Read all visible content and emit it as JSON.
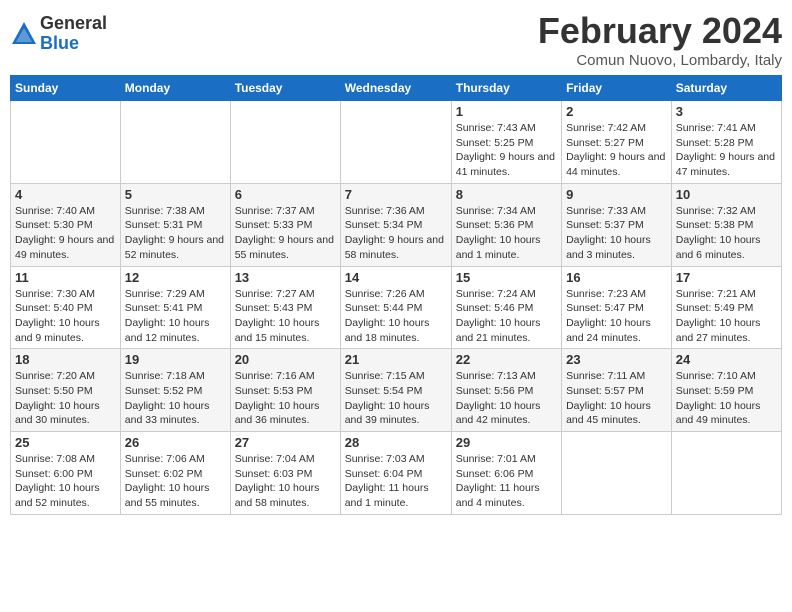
{
  "logo": {
    "general": "General",
    "blue": "Blue"
  },
  "header": {
    "month": "February 2024",
    "location": "Comun Nuovo, Lombardy, Italy"
  },
  "weekdays": [
    "Sunday",
    "Monday",
    "Tuesday",
    "Wednesday",
    "Thursday",
    "Friday",
    "Saturday"
  ],
  "weeks": [
    [
      {
        "day": "",
        "info": ""
      },
      {
        "day": "",
        "info": ""
      },
      {
        "day": "",
        "info": ""
      },
      {
        "day": "",
        "info": ""
      },
      {
        "day": "1",
        "info": "Sunrise: 7:43 AM\nSunset: 5:25 PM\nDaylight: 9 hours\nand 41 minutes."
      },
      {
        "day": "2",
        "info": "Sunrise: 7:42 AM\nSunset: 5:27 PM\nDaylight: 9 hours\nand 44 minutes."
      },
      {
        "day": "3",
        "info": "Sunrise: 7:41 AM\nSunset: 5:28 PM\nDaylight: 9 hours\nand 47 minutes."
      }
    ],
    [
      {
        "day": "4",
        "info": "Sunrise: 7:40 AM\nSunset: 5:30 PM\nDaylight: 9 hours\nand 49 minutes."
      },
      {
        "day": "5",
        "info": "Sunrise: 7:38 AM\nSunset: 5:31 PM\nDaylight: 9 hours\nand 52 minutes."
      },
      {
        "day": "6",
        "info": "Sunrise: 7:37 AM\nSunset: 5:33 PM\nDaylight: 9 hours\nand 55 minutes."
      },
      {
        "day": "7",
        "info": "Sunrise: 7:36 AM\nSunset: 5:34 PM\nDaylight: 9 hours\nand 58 minutes."
      },
      {
        "day": "8",
        "info": "Sunrise: 7:34 AM\nSunset: 5:36 PM\nDaylight: 10 hours\nand 1 minute."
      },
      {
        "day": "9",
        "info": "Sunrise: 7:33 AM\nSunset: 5:37 PM\nDaylight: 10 hours\nand 3 minutes."
      },
      {
        "day": "10",
        "info": "Sunrise: 7:32 AM\nSunset: 5:38 PM\nDaylight: 10 hours\nand 6 minutes."
      }
    ],
    [
      {
        "day": "11",
        "info": "Sunrise: 7:30 AM\nSunset: 5:40 PM\nDaylight: 10 hours\nand 9 minutes."
      },
      {
        "day": "12",
        "info": "Sunrise: 7:29 AM\nSunset: 5:41 PM\nDaylight: 10 hours\nand 12 minutes."
      },
      {
        "day": "13",
        "info": "Sunrise: 7:27 AM\nSunset: 5:43 PM\nDaylight: 10 hours\nand 15 minutes."
      },
      {
        "day": "14",
        "info": "Sunrise: 7:26 AM\nSunset: 5:44 PM\nDaylight: 10 hours\nand 18 minutes."
      },
      {
        "day": "15",
        "info": "Sunrise: 7:24 AM\nSunset: 5:46 PM\nDaylight: 10 hours\nand 21 minutes."
      },
      {
        "day": "16",
        "info": "Sunrise: 7:23 AM\nSunset: 5:47 PM\nDaylight: 10 hours\nand 24 minutes."
      },
      {
        "day": "17",
        "info": "Sunrise: 7:21 AM\nSunset: 5:49 PM\nDaylight: 10 hours\nand 27 minutes."
      }
    ],
    [
      {
        "day": "18",
        "info": "Sunrise: 7:20 AM\nSunset: 5:50 PM\nDaylight: 10 hours\nand 30 minutes."
      },
      {
        "day": "19",
        "info": "Sunrise: 7:18 AM\nSunset: 5:52 PM\nDaylight: 10 hours\nand 33 minutes."
      },
      {
        "day": "20",
        "info": "Sunrise: 7:16 AM\nSunset: 5:53 PM\nDaylight: 10 hours\nand 36 minutes."
      },
      {
        "day": "21",
        "info": "Sunrise: 7:15 AM\nSunset: 5:54 PM\nDaylight: 10 hours\nand 39 minutes."
      },
      {
        "day": "22",
        "info": "Sunrise: 7:13 AM\nSunset: 5:56 PM\nDaylight: 10 hours\nand 42 minutes."
      },
      {
        "day": "23",
        "info": "Sunrise: 7:11 AM\nSunset: 5:57 PM\nDaylight: 10 hours\nand 45 minutes."
      },
      {
        "day": "24",
        "info": "Sunrise: 7:10 AM\nSunset: 5:59 PM\nDaylight: 10 hours\nand 49 minutes."
      }
    ],
    [
      {
        "day": "25",
        "info": "Sunrise: 7:08 AM\nSunset: 6:00 PM\nDaylight: 10 hours\nand 52 minutes."
      },
      {
        "day": "26",
        "info": "Sunrise: 7:06 AM\nSunset: 6:02 PM\nDaylight: 10 hours\nand 55 minutes."
      },
      {
        "day": "27",
        "info": "Sunrise: 7:04 AM\nSunset: 6:03 PM\nDaylight: 10 hours\nand 58 minutes."
      },
      {
        "day": "28",
        "info": "Sunrise: 7:03 AM\nSunset: 6:04 PM\nDaylight: 11 hours\nand 1 minute."
      },
      {
        "day": "29",
        "info": "Sunrise: 7:01 AM\nSunset: 6:06 PM\nDaylight: 11 hours\nand 4 minutes."
      },
      {
        "day": "",
        "info": ""
      },
      {
        "day": "",
        "info": ""
      }
    ]
  ]
}
